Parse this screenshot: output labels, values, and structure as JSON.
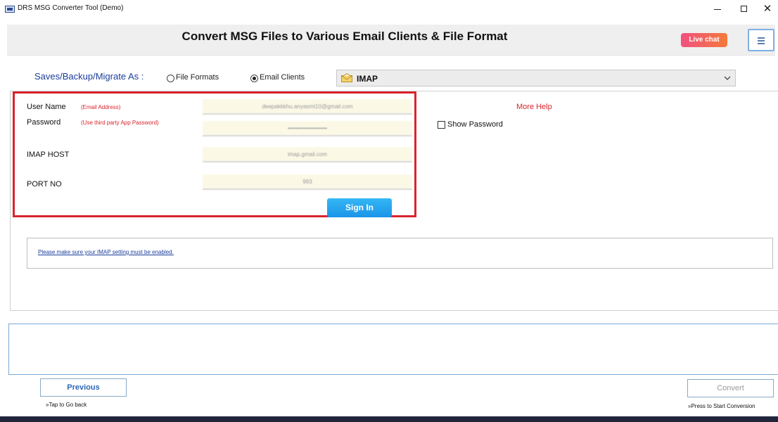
{
  "window": {
    "title": "DRS MSG Converter Tool (Demo)",
    "minimize_icon": "minimize-icon",
    "maximize_icon": "maximize-icon",
    "close_icon": "close-icon",
    "close_glyph": "✕"
  },
  "header": {
    "title": "Convert MSG Files to Various Email Clients & File Format",
    "live_chat_label": "Live chat",
    "menu_icon": "hamburger-menu-icon"
  },
  "saves": {
    "label": "Saves/Backup/Migrate As :",
    "options": [
      {
        "label": "File Formats",
        "selected": false
      },
      {
        "label": "Email Clients",
        "selected": true
      }
    ],
    "selected_client": "IMAP",
    "client_icon": "mail-envelope-icon"
  },
  "login": {
    "user_name_label": "User Name",
    "user_name_hint": "(Email Address)",
    "user_name_value": "deepakkkhu.anyasmt10@gmail.com",
    "password_label": "Password",
    "password_hint": "(Use third party App Password)",
    "password_value": "••••••••••••••••••••",
    "imap_host_label": "IMAP HOST",
    "imap_host_value": "imap.gmail.com",
    "port_label": "PORT NO",
    "port_value": "993",
    "sign_in_label": "Sign In",
    "more_help_label": "More Help",
    "show_password_label": "Show Password"
  },
  "note": {
    "text": "Please make sure your IMAP setting must be enabled."
  },
  "footer": {
    "previous_label": "Previous",
    "previous_hint": "»Tap to Go back",
    "convert_label": "Convert",
    "convert_hint": "»Press to Start Conversion"
  },
  "colors": {
    "accent_blue": "#1b94e8",
    "highlight_red": "#d9242d",
    "label_blue": "#1a3d9b"
  }
}
